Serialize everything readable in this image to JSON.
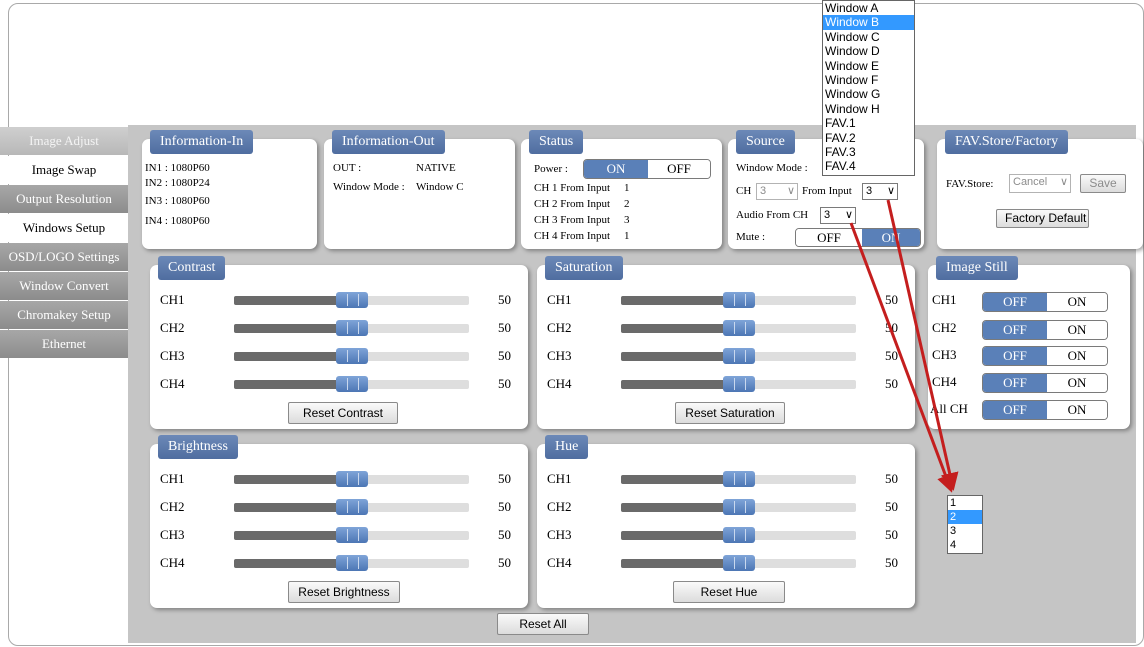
{
  "nav": [
    {
      "label": "Image Adjust",
      "state": "selected"
    },
    {
      "label": "Image Swap",
      "state": "inactive"
    },
    {
      "label": "Output Resolution",
      "state": "normal"
    },
    {
      "label": "Windows Setup",
      "state": "inactive"
    },
    {
      "label": "OSD/LOGO Settings",
      "state": "normal"
    },
    {
      "label": "Window Convert",
      "state": "normal"
    },
    {
      "label": "Chromakey Setup",
      "state": "normal"
    },
    {
      "label": "Ethernet",
      "state": "normal"
    }
  ],
  "info_in": {
    "title": "Information-In",
    "lines": [
      "IN1 : 1080P60",
      "IN2 : 1080P24",
      "IN3 : 1080P60",
      "IN4 : 1080P60"
    ]
  },
  "info_out": {
    "title": "Information-Out",
    "out_label": "OUT :",
    "out_value": "NATIVE",
    "mode_label": "Window Mode :",
    "mode_value": "Window C"
  },
  "status": {
    "title": "Status",
    "power_label": "Power :",
    "on": "ON",
    "off": "OFF",
    "lines": [
      {
        "label": "CH 1 From Input",
        "value": "1"
      },
      {
        "label": "CH 2 From Input",
        "value": "2"
      },
      {
        "label": "CH 3 From Input",
        "value": "3"
      },
      {
        "label": "CH 4 From Input",
        "value": "1"
      }
    ]
  },
  "source": {
    "title": "Source",
    "window_mode_label": "Window Mode :",
    "ch_label": "CH",
    "ch_value": "3",
    "from_input_label": "From Input",
    "from_input_value": "3",
    "audio_label": "Audio From CH",
    "audio_value": "3",
    "mute_label": "Mute :",
    "off": "OFF",
    "on": "ON"
  },
  "window_dropdown": {
    "options": [
      "Window A",
      "Window B",
      "Window C",
      "Window D",
      "Window E",
      "Window F",
      "Window G",
      "Window H",
      "FAV.1",
      "FAV.2",
      "FAV.3",
      "FAV.4"
    ],
    "highlighted": 1
  },
  "fav": {
    "title": "FAV.Store/Factory",
    "store_label": "FAV.Store:",
    "store_value": "Cancel",
    "save": "Save",
    "factory": "Factory Default"
  },
  "contrast": {
    "title": "Contrast",
    "reset": "Reset Contrast",
    "rows": [
      {
        "ch": "CH1",
        "value": "50"
      },
      {
        "ch": "CH2",
        "value": "50"
      },
      {
        "ch": "CH3",
        "value": "50"
      },
      {
        "ch": "CH4",
        "value": "50"
      }
    ]
  },
  "saturation": {
    "title": "Saturation",
    "reset": "Reset Saturation",
    "rows": [
      {
        "ch": "CH1",
        "value": "50"
      },
      {
        "ch": "CH2",
        "value": "50"
      },
      {
        "ch": "CH3",
        "value": "50"
      },
      {
        "ch": "CH4",
        "value": "50"
      }
    ]
  },
  "brightness": {
    "title": "Brightness",
    "reset": "Reset Brightness",
    "rows": [
      {
        "ch": "CH1",
        "value": "50"
      },
      {
        "ch": "CH2",
        "value": "50"
      },
      {
        "ch": "CH3",
        "value": "50"
      },
      {
        "ch": "CH4",
        "value": "50"
      }
    ]
  },
  "hue": {
    "title": "Hue",
    "reset": "Reset Hue",
    "rows": [
      {
        "ch": "CH1",
        "value": "50"
      },
      {
        "ch": "CH2",
        "value": "50"
      },
      {
        "ch": "CH3",
        "value": "50"
      },
      {
        "ch": "CH4",
        "value": "50"
      }
    ]
  },
  "slider_range": {
    "min": 0,
    "max": 100
  },
  "image_still": {
    "title": "Image Still",
    "rows": [
      {
        "ch": "CH1",
        "off": "OFF",
        "on": "ON"
      },
      {
        "ch": "CH2",
        "off": "OFF",
        "on": "ON"
      },
      {
        "ch": "CH3",
        "off": "OFF",
        "on": "ON"
      },
      {
        "ch": "CH4",
        "off": "OFF",
        "on": "ON"
      },
      {
        "ch": "All CH",
        "off": "OFF",
        "on": "ON"
      }
    ]
  },
  "input_dropdown": {
    "options": [
      "1",
      "2",
      "3",
      "4"
    ],
    "highlighted": 1
  },
  "reset_all": "Reset All",
  "colors": {
    "accent": "#5a80b8",
    "annotation_arrow": "#c41e1e"
  }
}
